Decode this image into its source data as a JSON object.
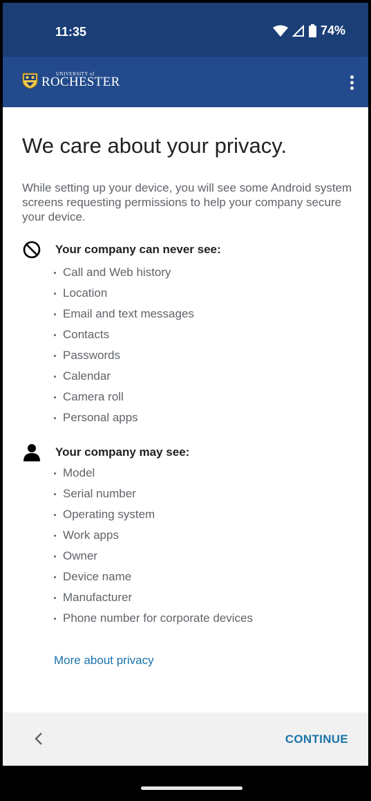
{
  "status": {
    "time": "11:35",
    "battery": "74%",
    "icons": [
      "wifi-icon",
      "cell-signal-icon",
      "battery-icon"
    ]
  },
  "appbar": {
    "logo_small": "UNIVERSITY of",
    "logo_name": "ROCHESTER",
    "menu_icon": "more-vert-icon"
  },
  "main": {
    "title": "We care about your privacy.",
    "intro": "While setting up your device, you will see some Android system screens requesting permissions to help your company secure your device.",
    "never_see": {
      "heading": "Your company can never see:",
      "icon": "block-icon",
      "items": [
        "Call and Web history",
        "Location",
        "Email and text messages",
        "Contacts",
        "Passwords",
        "Calendar",
        "Camera roll",
        "Personal apps"
      ]
    },
    "may_see": {
      "heading": "Your company may see:",
      "icon": "person-icon",
      "items": [
        "Model",
        "Serial number",
        "Operating system",
        "Work apps",
        "Owner",
        "Device name",
        "Manufacturer",
        "Phone number for corporate devices"
      ]
    },
    "more_link": "More about privacy"
  },
  "footer": {
    "back_icon": "chevron-left-icon",
    "continue_label": "CONTINUE"
  },
  "colors": {
    "statusbar": "#1b3e77",
    "appbar": "#224a8c",
    "accent": "#1a73ab",
    "footer": "#f1f1f1"
  }
}
